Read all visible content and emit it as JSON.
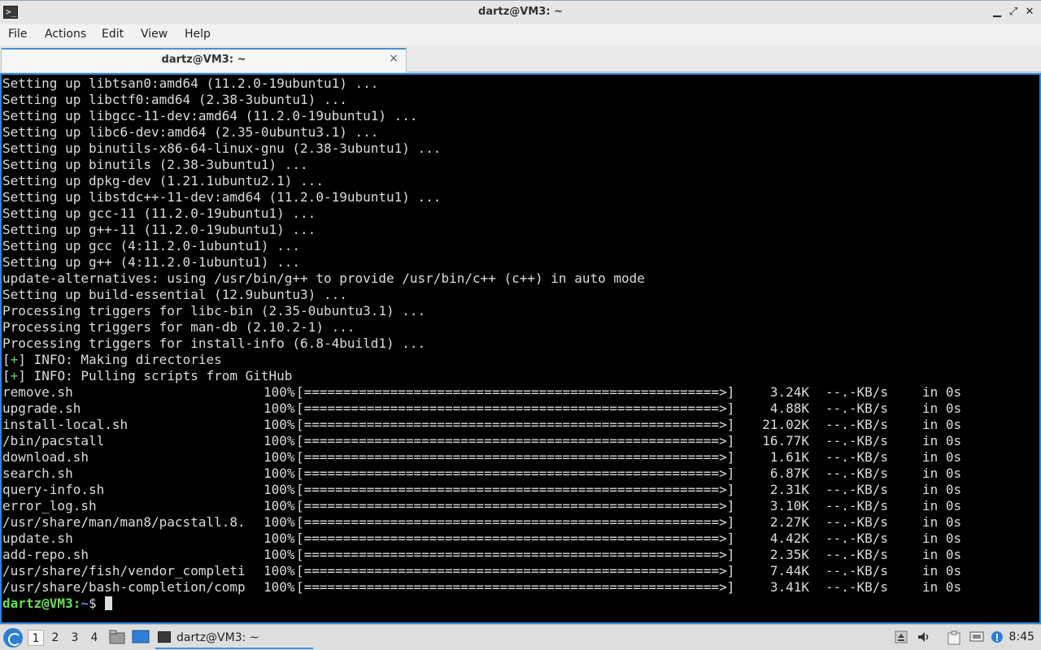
{
  "window": {
    "title": "dartz@VM3: ~",
    "minimize": "▁",
    "restore": "⤢",
    "close": "✕"
  },
  "menu": [
    "File",
    "Actions",
    "Edit",
    "View",
    "Help"
  ],
  "tab": {
    "label": "dartz@VM3: ~",
    "close": "×"
  },
  "terminal": {
    "lines": [
      "Setting up libtsan0:amd64 (11.2.0-19ubuntu1) ...",
      "Setting up libctf0:amd64 (2.38-3ubuntu1) ...",
      "Setting up libgcc-11-dev:amd64 (11.2.0-19ubuntu1) ...",
      "Setting up libc6-dev:amd64 (2.35-0ubuntu3.1) ...",
      "Setting up binutils-x86-64-linux-gnu (2.38-3ubuntu1) ...",
      "Setting up binutils (2.38-3ubuntu1) ...",
      "Setting up dpkg-dev (1.21.1ubuntu2.1) ...",
      "Setting up libstdc++-11-dev:amd64 (11.2.0-19ubuntu1) ...",
      "Setting up gcc-11 (11.2.0-19ubuntu1) ...",
      "Setting up g++-11 (11.2.0-19ubuntu1) ...",
      "Setting up gcc (4:11.2.0-1ubuntu1) ...",
      "Setting up g++ (4:11.2.0-1ubuntu1) ...",
      "update-alternatives: using /usr/bin/g++ to provide /usr/bin/c++ (c++) in auto mode",
      "Setting up build-essential (12.9ubuntu3) ...",
      "Processing triggers for libc-bin (2.35-0ubuntu3.1) ...",
      "Processing triggers for man-db (2.10.2-1) ...",
      "Processing triggers for install-info (6.8-4build1) ..."
    ],
    "info_lines": [
      {
        "mark": "+",
        "text": " INFO: Making directories"
      },
      {
        "mark": "+",
        "text": " INFO: Pulling scripts from GitHub"
      }
    ],
    "downloads": [
      {
        "file": "remove.sh",
        "percent": "100%",
        "size": "3.24K",
        "speed": "--.-KB/s",
        "time": "in 0s"
      },
      {
        "file": "upgrade.sh",
        "percent": "100%",
        "size": "4.88K",
        "speed": "--.-KB/s",
        "time": "in 0s"
      },
      {
        "file": "install-local.sh",
        "percent": "100%",
        "size": "21.02K",
        "speed": "--.-KB/s",
        "time": "in 0s"
      },
      {
        "file": "/bin/pacstall",
        "percent": "100%",
        "size": "16.77K",
        "speed": "--.-KB/s",
        "time": "in 0s"
      },
      {
        "file": "download.sh",
        "percent": "100%",
        "size": "1.61K",
        "speed": "--.-KB/s",
        "time": "in 0s"
      },
      {
        "file": "search.sh",
        "percent": "100%",
        "size": "6.87K",
        "speed": "--.-KB/s",
        "time": "in 0s"
      },
      {
        "file": "query-info.sh",
        "percent": "100%",
        "size": "2.31K",
        "speed": "--.-KB/s",
        "time": "in 0s"
      },
      {
        "file": "error_log.sh",
        "percent": "100%",
        "size": "3.10K",
        "speed": "--.-KB/s",
        "time": "in 0s"
      },
      {
        "file": "/usr/share/man/man8/pacstall.8.",
        "percent": "100%",
        "size": "2.27K",
        "speed": "--.-KB/s",
        "time": "in 0s"
      },
      {
        "file": "update.sh",
        "percent": "100%",
        "size": "4.42K",
        "speed": "--.-KB/s",
        "time": "in 0s"
      },
      {
        "file": "add-repo.sh",
        "percent": "100%",
        "size": "2.35K",
        "speed": "--.-KB/s",
        "time": "in 0s"
      },
      {
        "file": "/usr/share/fish/vendor_completi",
        "percent": "100%",
        "size": "7.44K",
        "speed": "--.-KB/s",
        "time": "in 0s"
      },
      {
        "file": "/usr/share/bash-completion/comp",
        "percent": "100%",
        "size": "3.41K",
        "speed": "--.-KB/s",
        "time": "in 0s"
      }
    ],
    "progress_bar": "[=====================================================>]",
    "prompt": {
      "user": "dartz@VM3",
      "sep": ":",
      "path": "~",
      "symbol": "$ "
    }
  },
  "taskbar": {
    "desktops": [
      "1",
      "2",
      "3",
      "4"
    ],
    "active_desktop": "1",
    "task_label": "dartz@VM3: ~",
    "clock": "8:45"
  },
  "colors": {
    "terminal_bg": "#000000",
    "terminal_fg": "#dcdcdc",
    "prompt_user": "#6dde5a",
    "prompt_path": "#5c8fe0",
    "accent": "#2a86e0"
  }
}
